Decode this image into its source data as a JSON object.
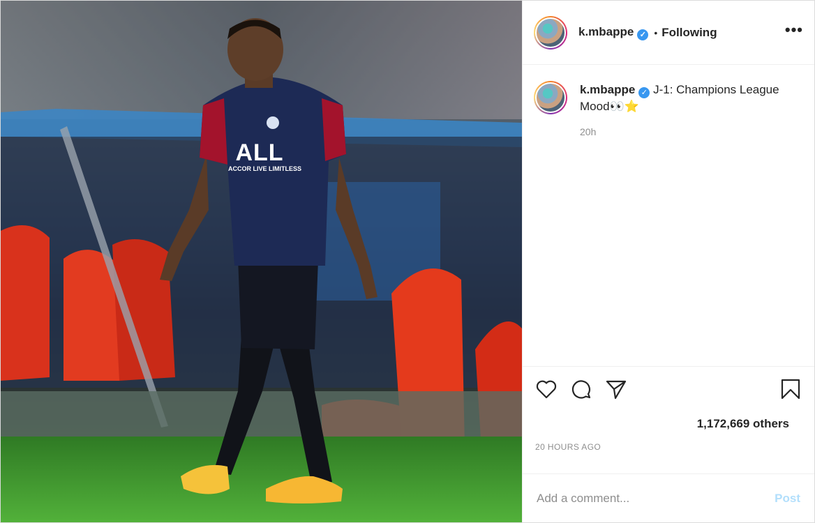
{
  "post": {
    "username": "k.mbappe",
    "follow_separator": "•",
    "follow_state": "Following",
    "more_icon": "more-horizontal-icon",
    "caption": {
      "text": "J-1: Champions League Mood",
      "emojis": "👀⭐",
      "time": "20h"
    },
    "likes": "1,172,669 others",
    "timestamp": "20 HOURS AGO",
    "comment_placeholder": "Add a comment...",
    "post_label": "Post",
    "icons": {
      "like": "heart-icon",
      "comment": "comment-icon",
      "share": "send-icon",
      "save": "bookmark-icon",
      "verified": "verified-badge-icon"
    },
    "photo": {
      "jersey_sponsor": "ALL",
      "jersey_sponsor_sub": "ACCOR LIVE LIMITLESS"
    }
  },
  "colors": {
    "verified": "#3897f0",
    "post_button": "#b2dffc",
    "muted_text": "#8e8e8e",
    "border": "#efefef"
  }
}
